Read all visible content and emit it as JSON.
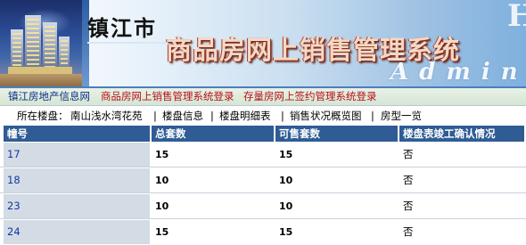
{
  "banner": {
    "city_title": "镇江市",
    "system_title": "商品房网上销售管理系统",
    "admin_text": "Admini",
    "corner_letter": "H"
  },
  "links": {
    "home": "镇江房地产信息网",
    "sales_login": "商品房网上销售管理系统登录",
    "stock_login": "存量房网上签约管理系统登录"
  },
  "crumbs": {
    "label": "所在楼盘：",
    "project_name": "南山浅水湾花苑",
    "separator": "|",
    "tabs": [
      "楼盘信息",
      "楼盘明细表",
      "销售状况概览图",
      "房型一览"
    ]
  },
  "table": {
    "headers": [
      "幢号",
      "总套数",
      "可售套数",
      "楼盘表竣工确认情况"
    ],
    "rows": [
      {
        "building": "17",
        "total": "15",
        "available": "15",
        "confirmed": "否"
      },
      {
        "building": "18",
        "total": "10",
        "available": "10",
        "confirmed": "否"
      },
      {
        "building": "23",
        "total": "10",
        "available": "10",
        "confirmed": "否"
      },
      {
        "building": "24",
        "total": "15",
        "available": "15",
        "confirmed": "否"
      }
    ]
  },
  "colors": {
    "header_bg": "#2f5c94",
    "link_red": "#b8101a",
    "link_blue": "#0c2f86"
  }
}
